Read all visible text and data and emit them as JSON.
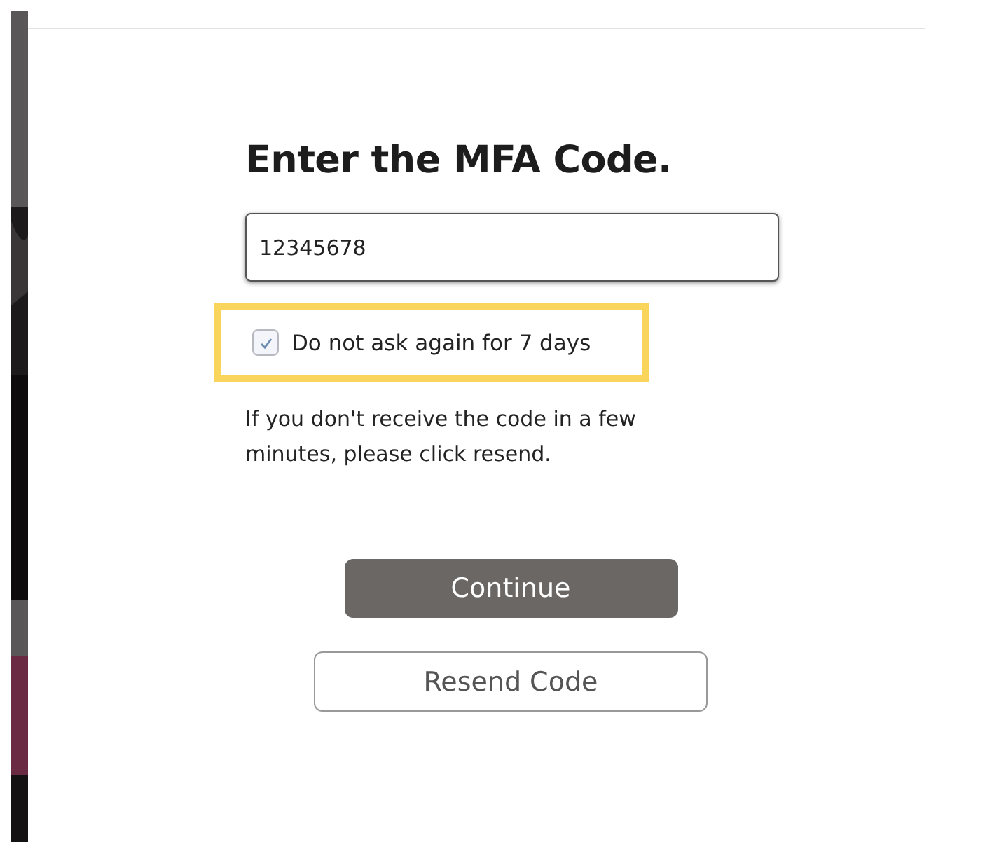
{
  "title": "Enter the MFA Code.",
  "code_field": {
    "value": "12345678"
  },
  "remember": {
    "label": "Do not ask again for 7 days",
    "checked": true,
    "highlighted": true
  },
  "hint": "If you don't receive the code in a few minutes, please click resend.",
  "buttons": [
    {
      "label": "Continue",
      "kind": "primary"
    },
    {
      "label": "Resend Code",
      "kind": "secondary"
    }
  ]
}
